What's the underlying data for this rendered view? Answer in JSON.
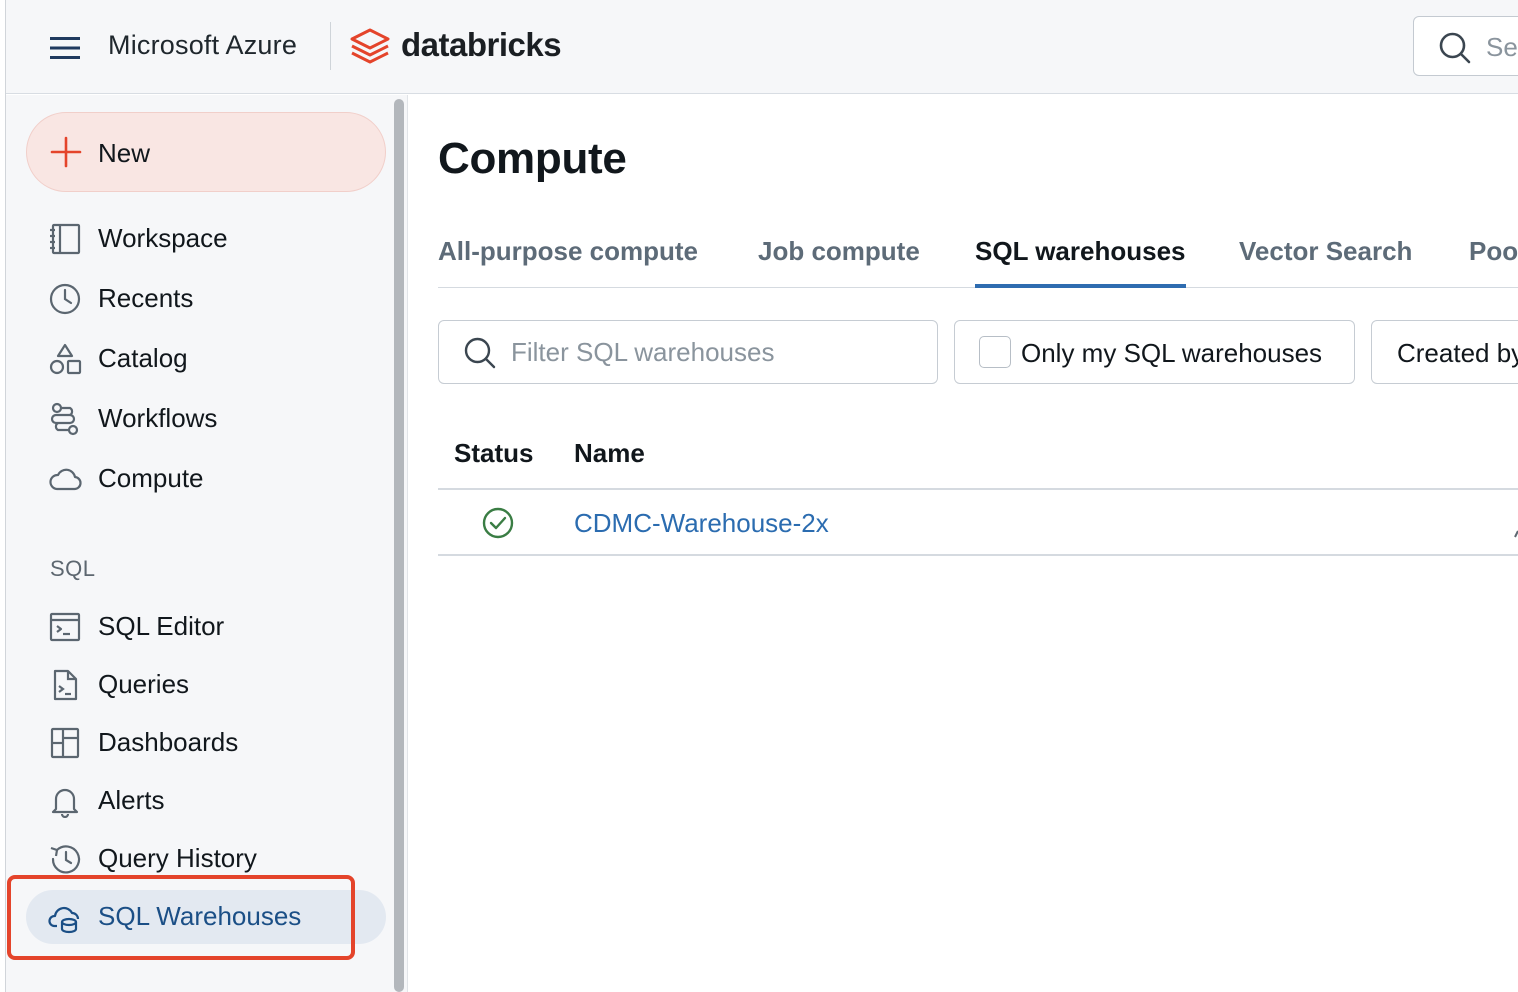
{
  "topbar": {
    "azure_label": "Microsoft Azure",
    "brand_label": "databricks",
    "search_placeholder": "Se"
  },
  "sidebar": {
    "new_label": "New",
    "items": [
      {
        "label": "Workspace",
        "icon": "workspace-icon"
      },
      {
        "label": "Recents",
        "icon": "clock-icon"
      },
      {
        "label": "Catalog",
        "icon": "catalog-icon"
      },
      {
        "label": "Workflows",
        "icon": "workflows-icon"
      },
      {
        "label": "Compute",
        "icon": "cloud-icon"
      }
    ],
    "section_sql": "SQL",
    "sql_items": [
      {
        "label": "SQL Editor",
        "icon": "sql-editor-icon"
      },
      {
        "label": "Queries",
        "icon": "query-file-icon"
      },
      {
        "label": "Dashboards",
        "icon": "dashboard-icon"
      },
      {
        "label": "Alerts",
        "icon": "bell-icon"
      },
      {
        "label": "Query History",
        "icon": "history-icon"
      },
      {
        "label": "SQL Warehouses",
        "icon": "warehouse-icon",
        "active": true
      }
    ]
  },
  "main": {
    "title": "Compute",
    "tabs": [
      {
        "label": "All-purpose compute"
      },
      {
        "label": "Job compute"
      },
      {
        "label": "SQL warehouses",
        "active": true
      },
      {
        "label": "Vector Search"
      },
      {
        "label": "Poo"
      }
    ],
    "filter_placeholder": "Filter SQL warehouses",
    "only_mine_label": "Only my SQL warehouses",
    "created_by_label": "Created by",
    "table": {
      "headers": [
        "Status",
        "Name"
      ],
      "rows": [
        {
          "status": "running",
          "name": "CDMC-Warehouse-2x"
        }
      ]
    }
  },
  "colors": {
    "accent_blue": "#2e6cb0",
    "link_blue": "#2b6cb0",
    "brand_red": "#e4442b",
    "status_green": "#3a7d44",
    "new_button_bg": "#f9e6e3"
  }
}
